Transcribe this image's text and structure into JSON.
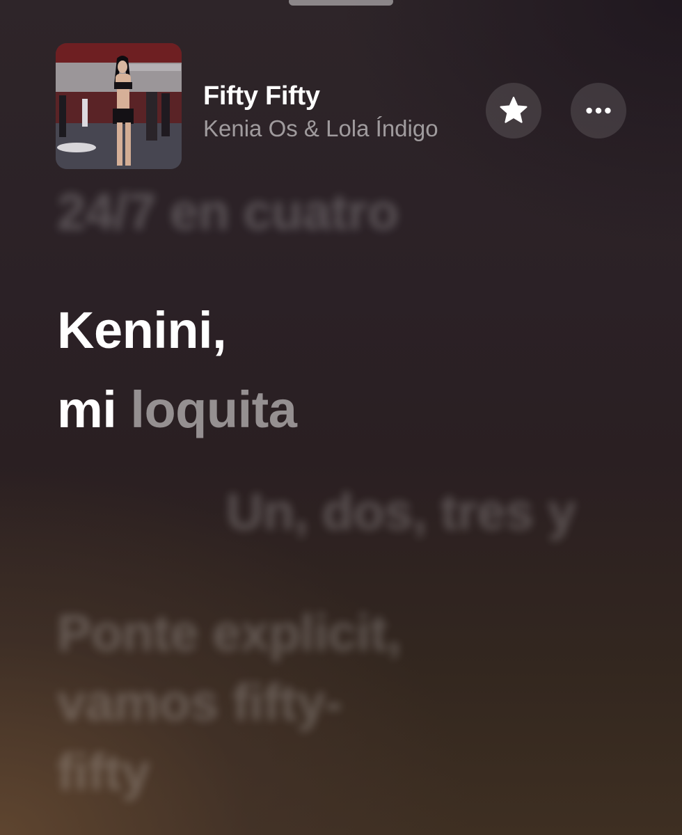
{
  "now_playing": {
    "title": "Fifty Fifty",
    "artist": "Kenia Os & Lola Índigo"
  },
  "buttons": {
    "favorite_icon": "star-icon",
    "more_icon": "ellipsis-icon"
  },
  "lyrics": {
    "previous": "24/7 en cuatro",
    "current": {
      "line1": "Kenini,",
      "line2_sung": "mi",
      "line2_unsung": "loquita"
    },
    "upcoming": [
      "Un, dos, tres y",
      "Ponte explicit,",
      "vamos fifty-",
      "fifty"
    ]
  },
  "colors": {
    "text_primary": "#ffffff"
  }
}
